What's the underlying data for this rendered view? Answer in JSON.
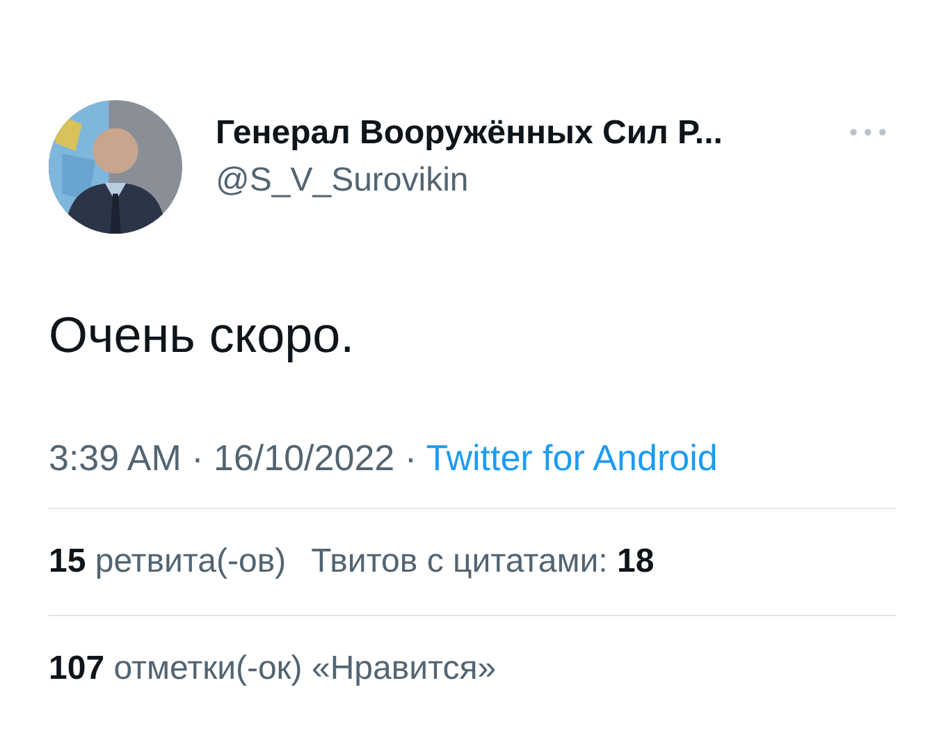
{
  "tweet": {
    "author_name": "Генерал Вооружённых Сил Р...",
    "handle": "@S_V_Surovikin",
    "more": "•••",
    "text": "Очень скоро.",
    "time": "3:39 AM · 16/10/2022 · ",
    "source": "Twitter for Android"
  },
  "stats": [
    [
      "**15** ретвита(-ов)",
      "Твитов с цитатами: **18**"
    ],
    [
      "**107** отметки(-ок) «Нравится»"
    ]
  ]
}
